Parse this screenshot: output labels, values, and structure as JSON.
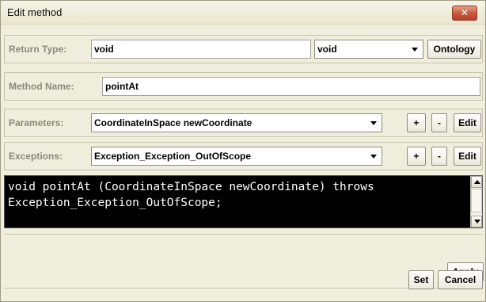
{
  "window": {
    "title": "Edit method",
    "close_glyph": "✕"
  },
  "return_type": {
    "label": "Return Type:",
    "value": "void",
    "combo_value": "void",
    "ontology_label": "Ontology"
  },
  "method_name": {
    "label": "Method Name:",
    "value": "pointAt"
  },
  "parameters": {
    "label": "Parameters:",
    "selected": "CoordinateInSpace newCoordinate",
    "add_label": "+",
    "remove_label": "-",
    "edit_label": "Edit"
  },
  "exceptions": {
    "label": "Exceptions:",
    "selected": "Exception_Exception_OutOfScope",
    "add_label": "+",
    "remove_label": "-",
    "edit_label": "Edit"
  },
  "signature": {
    "text": "void pointAt (CoordinateInSpace newCoordinate) throws\nException_Exception_OutOfScope;"
  },
  "actions": {
    "apply_label": "Apply",
    "set_label": "Set",
    "cancel_label": "Cancel"
  }
}
